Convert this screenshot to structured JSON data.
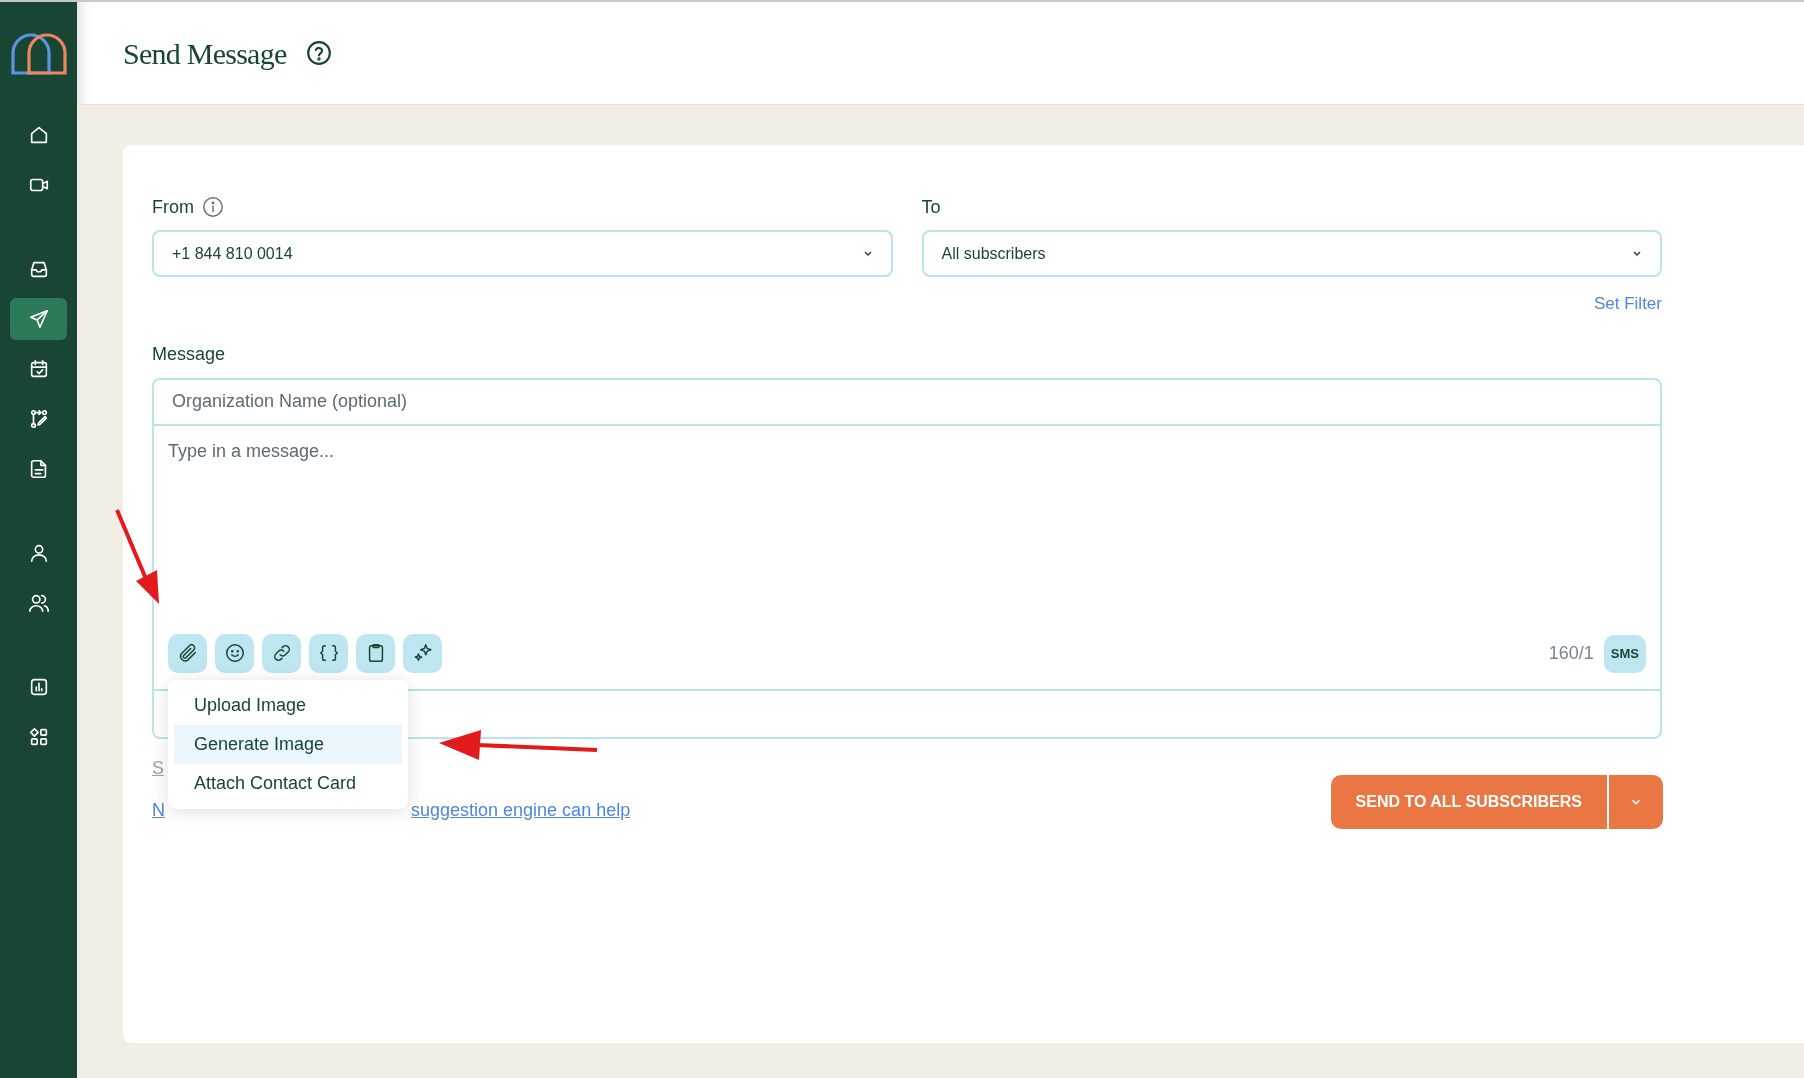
{
  "sidebar": {
    "groups": [
      {
        "items": [
          {
            "kind": "home",
            "selected": false
          },
          {
            "kind": "video",
            "selected": false
          }
        ]
      },
      {
        "items": [
          {
            "kind": "inbox",
            "selected": false
          },
          {
            "kind": "send",
            "selected": true
          },
          {
            "kind": "calendar",
            "selected": false
          },
          {
            "kind": "flow",
            "selected": false
          },
          {
            "kind": "document",
            "selected": false
          }
        ]
      },
      {
        "items": [
          {
            "kind": "user",
            "selected": false
          },
          {
            "kind": "users",
            "selected": false
          }
        ]
      },
      {
        "items": [
          {
            "kind": "chart",
            "selected": false
          },
          {
            "kind": "apps",
            "selected": false
          }
        ]
      }
    ]
  },
  "header": {
    "title": "Send Message"
  },
  "form": {
    "from": {
      "label": "From",
      "value": "+1 844 810 0014"
    },
    "to": {
      "label": "To",
      "value": "All subscribers"
    },
    "set_filter": "Set Filter",
    "message": {
      "label": "Message",
      "organization_placeholder": "Organization Name (optional)",
      "placeholder": "Type in a message...",
      "toolbar": [
        {
          "kind": "attach"
        },
        {
          "kind": "emoji"
        },
        {
          "kind": "link"
        },
        {
          "kind": "variables"
        },
        {
          "kind": "clipboard"
        },
        {
          "kind": "sparkle"
        }
      ],
      "counter": "160/1",
      "channel_badge": "SMS"
    },
    "attach_menu": {
      "items": [
        {
          "label": "Upload Image",
          "selected": false
        },
        {
          "label": "Generate Image",
          "selected": true
        },
        {
          "label": "Attach Contact Card",
          "selected": false
        }
      ]
    },
    "links": [
      {
        "visible_parts": [
          "S"
        ]
      },
      {
        "visible_parts": [
          "N",
          "suggestion engine can help"
        ]
      }
    ],
    "send_button": "SEND TO ALL SUBSCRIBERS"
  }
}
